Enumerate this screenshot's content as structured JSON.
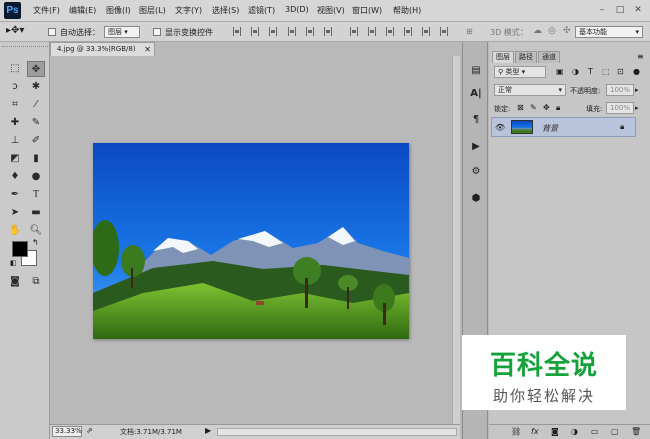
{
  "app": {
    "logo": "Ps"
  },
  "menu": [
    "文件(F)",
    "编辑(E)",
    "图像(I)",
    "图层(L)",
    "文字(Y)",
    "选择(S)",
    "滤镜(T)",
    "3D(D)",
    "视图(V)",
    "窗口(W)",
    "帮助(H)"
  ],
  "options": {
    "auto_select_label": "自动选择：",
    "auto_select_value": "图层",
    "show_transform_label": "显示变换控件",
    "mode3d_label": "3D 模式：",
    "workspace": "基本功能"
  },
  "document": {
    "tab_title": "4.jpg @ 33.3%(RGB/8)",
    "zoom": "33.33%",
    "doc_info": "文档:3.71M/3.71M"
  },
  "panels": {
    "tabs": [
      "图层",
      "路径",
      "通道"
    ],
    "filter_kind": "类型",
    "blend_mode": "正常",
    "opacity_label": "不透明度:",
    "opacity_value": "100%",
    "lock_label": "锁定:",
    "fill_label": "填充:",
    "fill_value": "100%",
    "layers": [
      {
        "name": "背景",
        "visible": true,
        "locked": true
      }
    ]
  },
  "watermark": {
    "title": "百科全说",
    "subtitle": "助你轻松解决"
  },
  "colors": {
    "accent": "#16a23a",
    "layer_selected": "#b9c4dc",
    "foreground": "#000000",
    "background": "#ffffff"
  }
}
